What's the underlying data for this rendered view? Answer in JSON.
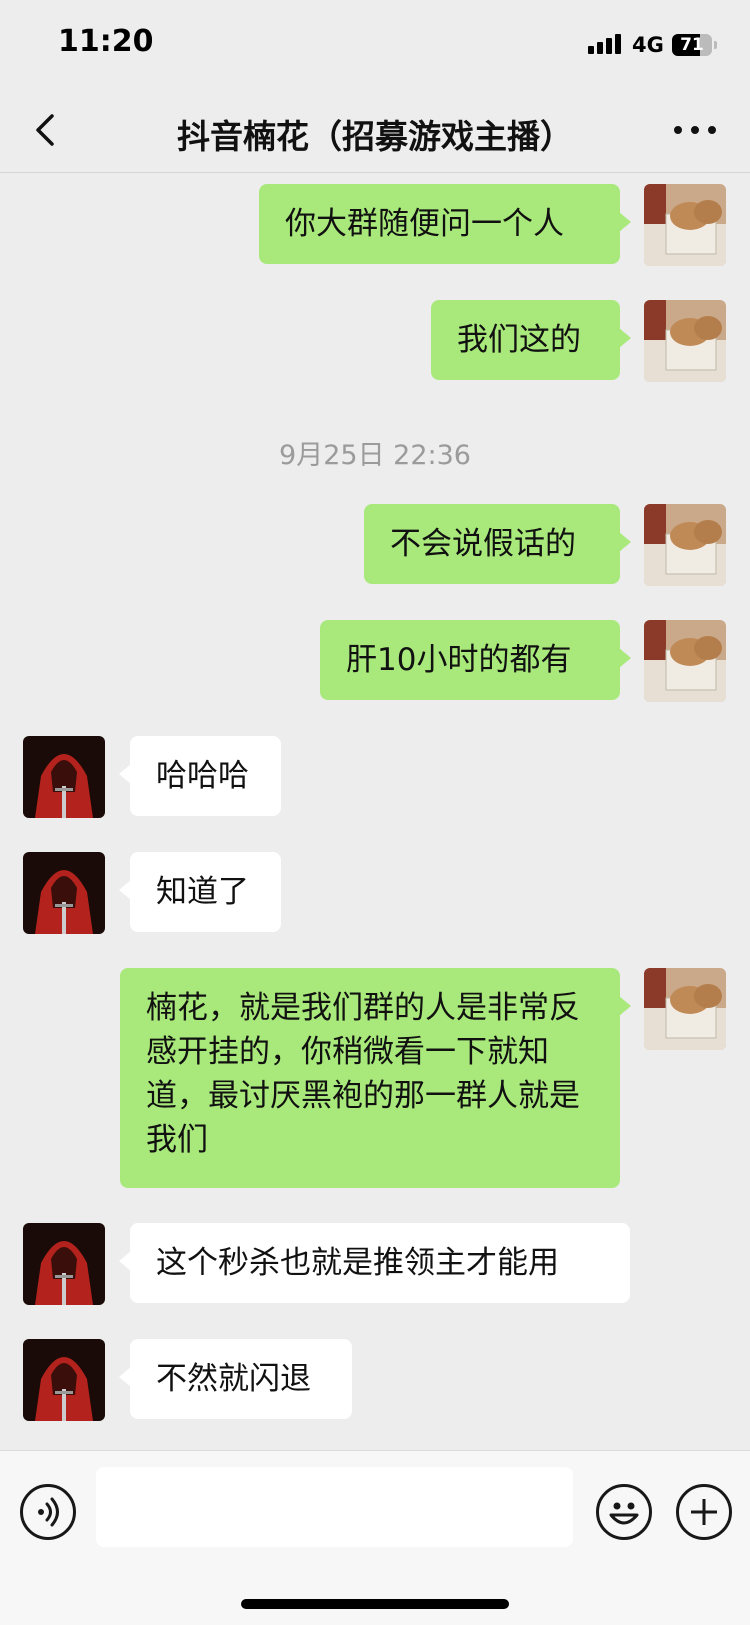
{
  "status_bar": {
    "time": "11:20",
    "network": "4G",
    "battery": "71"
  },
  "header": {
    "title": "抖音楠花（招募游戏主播）",
    "back_icon": "chevron-left-icon",
    "more_icon": "more-dots-icon"
  },
  "messages": [
    {
      "side": "right",
      "text": "你大群随便问一个人"
    },
    {
      "side": "right",
      "text": "我们这的"
    },
    {
      "timestamp": "9月25日 22:36"
    },
    {
      "side": "right",
      "text": "不会说假话的"
    },
    {
      "side": "right",
      "text": "肝10小时的都有"
    },
    {
      "side": "left",
      "text": "哈哈哈"
    },
    {
      "side": "left",
      "text": "知道了"
    },
    {
      "side": "right",
      "text": "楠花，就是我们群的人是非常反感开挂的，你稍微看一下就知道，最讨厌黑袍的那一群人就是我们"
    },
    {
      "side": "left",
      "text": "这个秒杀也就是推领主才能用"
    },
    {
      "side": "left",
      "text": "不然就闪退"
    }
  ],
  "input_bar": {
    "voice_icon": "voice-icon",
    "emoji_icon": "emoji-icon",
    "plus_icon": "plus-icon",
    "placeholder": ""
  },
  "colors": {
    "background": "#ededed",
    "sent_bubble": "#a9e97b",
    "received_bubble": "#ffffff"
  }
}
